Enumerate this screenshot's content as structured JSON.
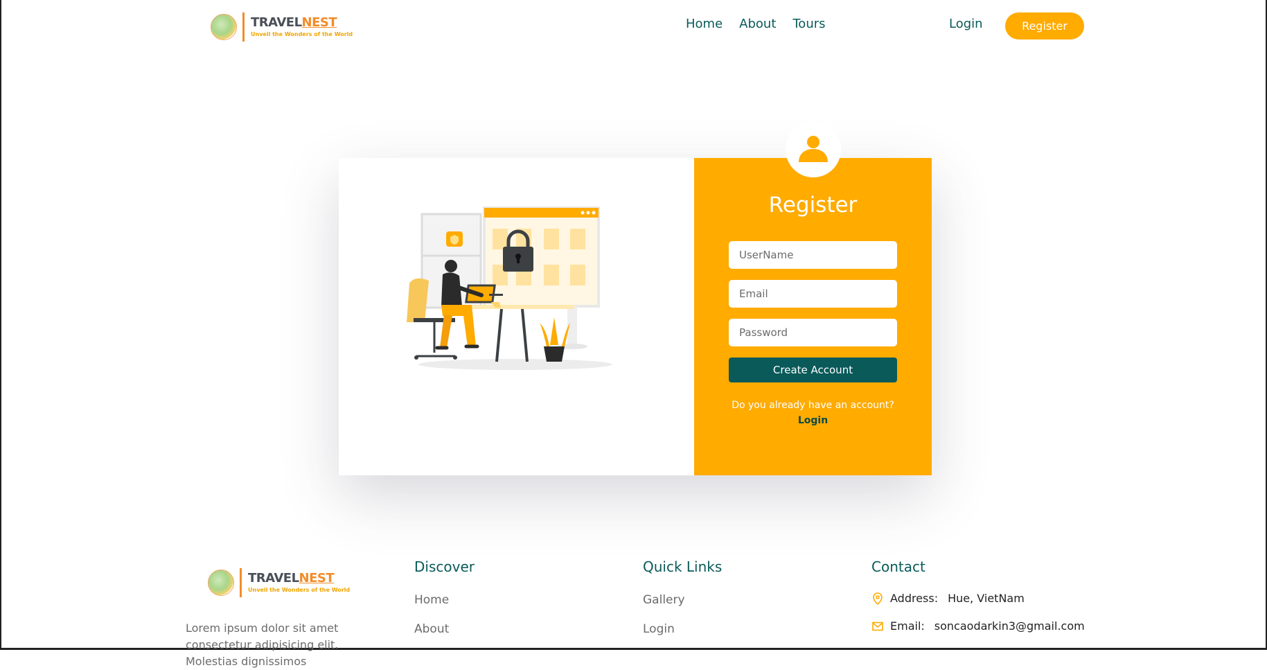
{
  "brand": {
    "word_part1": "TRAVEL",
    "word_part2": "NEST",
    "tagline": "Unveil the Wonders of the World"
  },
  "nav": {
    "items": [
      "Home",
      "About",
      "Tours"
    ],
    "login_label": "Login",
    "register_label": "Register"
  },
  "register_form": {
    "title": "Register",
    "username_placeholder": "UserName",
    "email_placeholder": "Email",
    "password_placeholder": "Password",
    "submit_label": "Create Account",
    "account_question": "Do you already have an account?",
    "login_link": "Login"
  },
  "footer": {
    "about_text": "Lorem ipsum dolor sit amet consectetur adipisicing elit. Molestias dignissimos",
    "discover": {
      "title": "Discover",
      "links": [
        "Home",
        "About"
      ]
    },
    "quick_links": {
      "title": "Quick Links",
      "links": [
        "Gallery",
        "Login"
      ]
    },
    "contact": {
      "title": "Contact",
      "address_label": "Address:",
      "address_value": "Hue, VietNam",
      "email_label": "Email:",
      "email_value": "soncaodarkin3@gmail.com"
    }
  },
  "colors": {
    "accent": "#ffab00",
    "primary": "#0a5a5a",
    "brand_orange": "#f28c28"
  },
  "icons": {
    "user": "user-avatar-icon",
    "location": "map-pin-icon",
    "mail": "mail-icon"
  }
}
